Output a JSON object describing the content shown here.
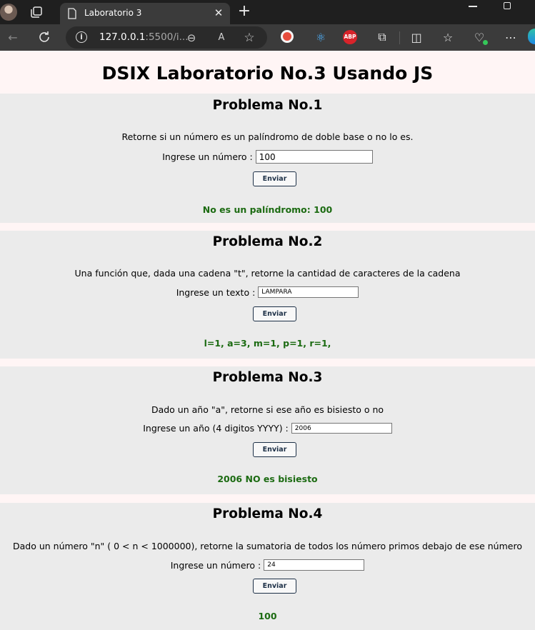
{
  "browser": {
    "tab_title": "Laboratorio 3",
    "url_host": "127.0.0.1",
    "url_rest": ":5500/i...",
    "extensions": {
      "adblock_label": "ABP"
    },
    "accent": "#3b3b3b"
  },
  "page": {
    "title": "DSIX Laboratorio No.3 Usando JS"
  },
  "problems": [
    {
      "heading": "Problema No.1",
      "description": "Retorne si un número es un palíndromo de doble base o no lo es.",
      "input_label": "Ingrese un número :",
      "input_value": "100",
      "button_label": "Enviar",
      "result": "No es un palíndromo: 100"
    },
    {
      "heading": "Problema No.2",
      "description": "Una función que, dada una cadena \"t\", retorne la cantidad de caracteres de la cadena",
      "input_label": "Ingrese un texto :",
      "input_value": "LAMPARA",
      "button_label": "Enviar",
      "result": "l=1, a=3, m=1, p=1, r=1,"
    },
    {
      "heading": "Problema No.3",
      "description": "Dado un año \"a\", retorne si ese año es bisiesto o no",
      "input_label": "Ingrese un año (4 digitos YYYY) :",
      "input_value": "2006",
      "button_label": "Enviar",
      "result": "2006 NO es bisiesto"
    },
    {
      "heading": "Problema No.4",
      "description": "Dado un número \"n\" ( 0 < n < 1000000), retorne la sumatoria de todos los número primos debajo de ese número",
      "input_label": "Ingrese un número :",
      "input_value": "24",
      "button_label": "Enviar",
      "result": "100"
    }
  ],
  "colors": {
    "result_text": "#1c6b12",
    "card_bg": "#ebebeb",
    "page_bg": "#fff5f5",
    "button_border": "#1c2f46"
  }
}
